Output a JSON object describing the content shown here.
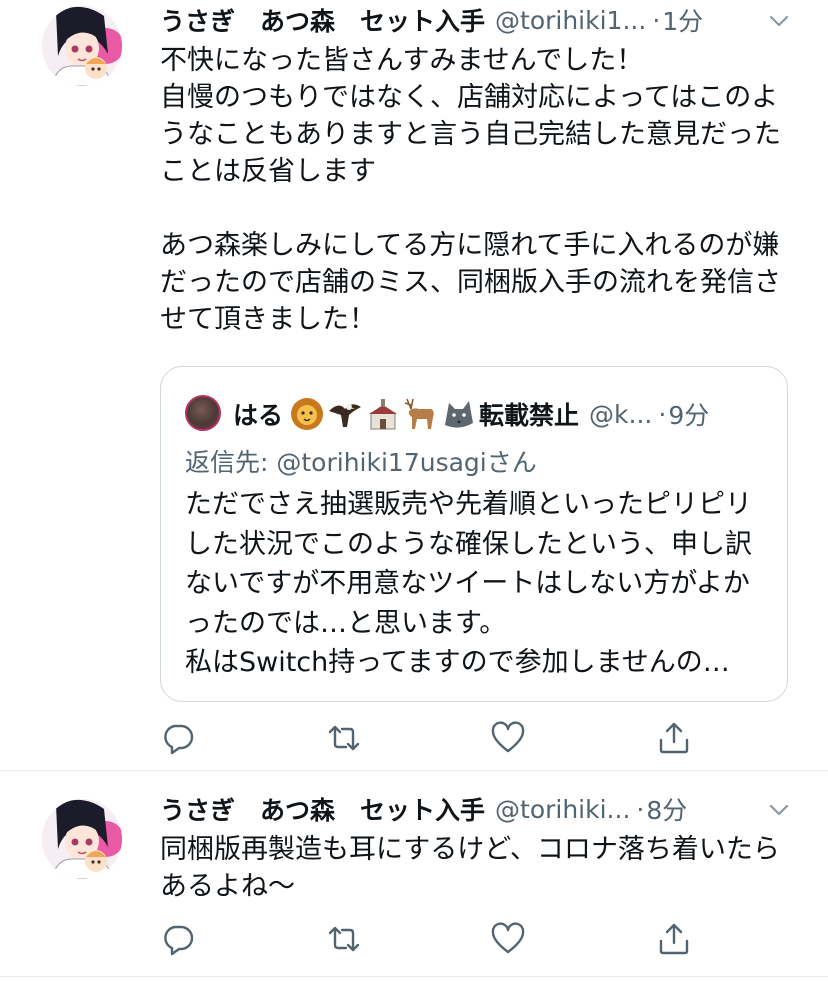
{
  "tweets": [
    {
      "display_name": "うさぎ　あつ森　セット入手",
      "handle": "@torihiki1...",
      "separator": "·",
      "time": "1分",
      "text": "不快になった皆さんすみませんでした！\n自慢のつもりではなく、店舗対応によってはこのようなこともありますと言う自己完結した意見だったことは反省します\n\nあつ森楽しみにしてる方に隠れて手に入れるのが嫌だったので店舗のミス、同梱版入手の流れを発信させて頂きました！",
      "quote": {
        "display_name": "はる",
        "name_suffix": "転載禁止",
        "handle": "@k...",
        "separator": "·",
        "time": "9分",
        "reply_prefix": "返信先: ",
        "reply_handle": "@torihiki17usagi",
        "reply_suffix": "さん",
        "text": "ただでさえ抽選販売や先着順といったピリピリした状況でこのような確保したという、申し訳ないですが不用意なツイートはしない方がよかったのでは…と思います。\n私はSwitch持ってますので参加しませんの…",
        "name_emojis": [
          "lion-emoji",
          "eagle-emoji",
          "church-emoji",
          "deer-emoji",
          "wolf-emoji"
        ]
      }
    },
    {
      "display_name": "うさぎ　あつ森　セット入手",
      "handle": "@torihiki...",
      "separator": "·",
      "time": "8分",
      "text": "同梱版再製造も耳にするけど、コロナ落ち着いたらあるよね〜"
    }
  ],
  "icons": {
    "reply": "reply-icon",
    "retweet": "retweet-icon",
    "like": "like-icon",
    "share": "share-icon",
    "caret": "chevron-down-icon"
  },
  "colors": {
    "text": "#0f1419",
    "secondary": "#536471",
    "border": "#cfd9de",
    "avatar_accent": "#e85aa6"
  }
}
